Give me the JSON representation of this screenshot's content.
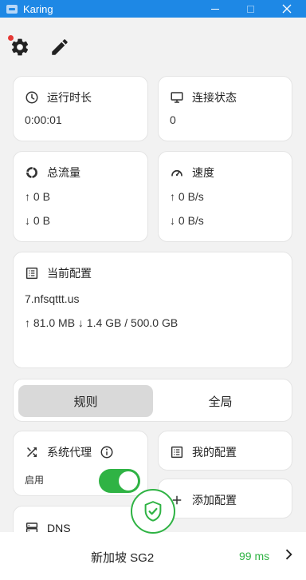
{
  "window": {
    "title": "Karing"
  },
  "cards": {
    "runtime": {
      "title": "运行时长",
      "value": "0:00:01"
    },
    "connection": {
      "title": "连接状态",
      "value": "0"
    },
    "traffic": {
      "title": "总流量",
      "up": "↑ 0 B",
      "down": "↓ 0 B"
    },
    "speed": {
      "title": "速度",
      "up": "↑ 0 B/s",
      "down": "↓ 0 B/s"
    },
    "current_profile": {
      "title": "当前配置",
      "name": "7.nfsqttt.us",
      "usage": "↑ 81.0 MB ↓ 1.4 GB / 500.0 GB"
    }
  },
  "mode_tabs": {
    "rules": "规则",
    "global": "全局",
    "selected": "rules"
  },
  "system_proxy": {
    "title": "系统代理",
    "toggle_label": "启用",
    "enabled": true
  },
  "my_profiles": {
    "label": "我的配置"
  },
  "add_profile": {
    "label": "添加配置"
  },
  "dns": {
    "label": "DNS"
  },
  "bottom": {
    "server": "新加坡 SG2",
    "latency": "99 ms"
  },
  "colors": {
    "titlebar": "#1e88e5",
    "accent_green": "#2fb344",
    "notification_dot": "#e53935"
  }
}
